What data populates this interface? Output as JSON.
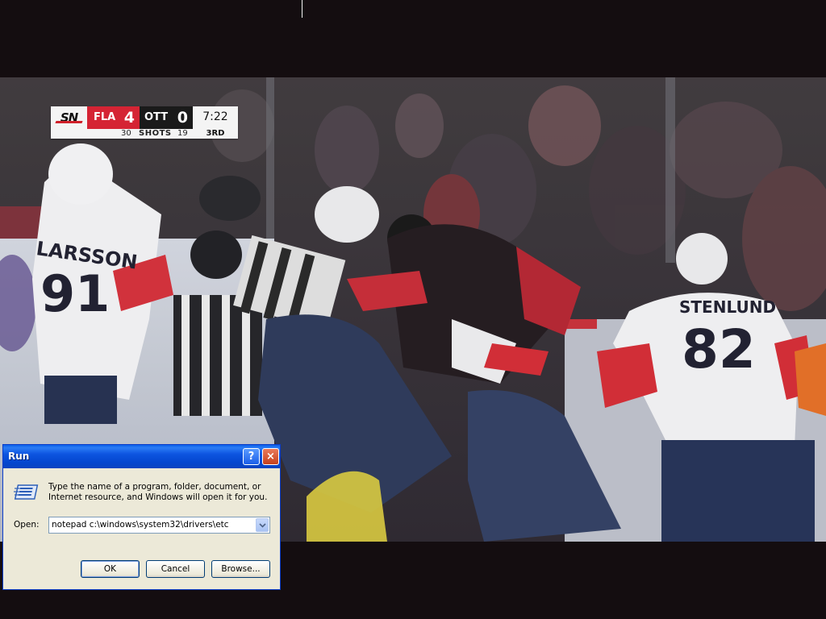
{
  "scoreboard": {
    "network": "SN",
    "home_team": "FLA",
    "home_score": "4",
    "away_team": "OTT",
    "away_score": "0",
    "clock": "7:22",
    "period": "3RD",
    "home_shots": "30",
    "shots_label": "SHOTS",
    "away_shots": "19"
  },
  "video": {
    "jersey_left_name": "LARSSON",
    "jersey_left_number": "91",
    "jersey_right_name": "STENLUND",
    "jersey_right_number": "82"
  },
  "run_dialog": {
    "title": "Run",
    "help_glyph": "?",
    "close_glyph": "×",
    "description": "Type the name of a program, folder, document, or Internet resource, and Windows will open it for you.",
    "open_label": "Open:",
    "open_value": "notepad c:\\windows\\system32\\drivers\\etc",
    "ok_label": "OK",
    "cancel_label": "Cancel",
    "browse_label": "Browse..."
  },
  "icons": {
    "run": "run-program-icon",
    "dropdown": "chevron-down-icon"
  },
  "colors": {
    "titlebar": "#0447cf",
    "dialog_face": "#ece9d8",
    "fla_red": "#d52434",
    "ott_black": "#1a1a1a"
  }
}
